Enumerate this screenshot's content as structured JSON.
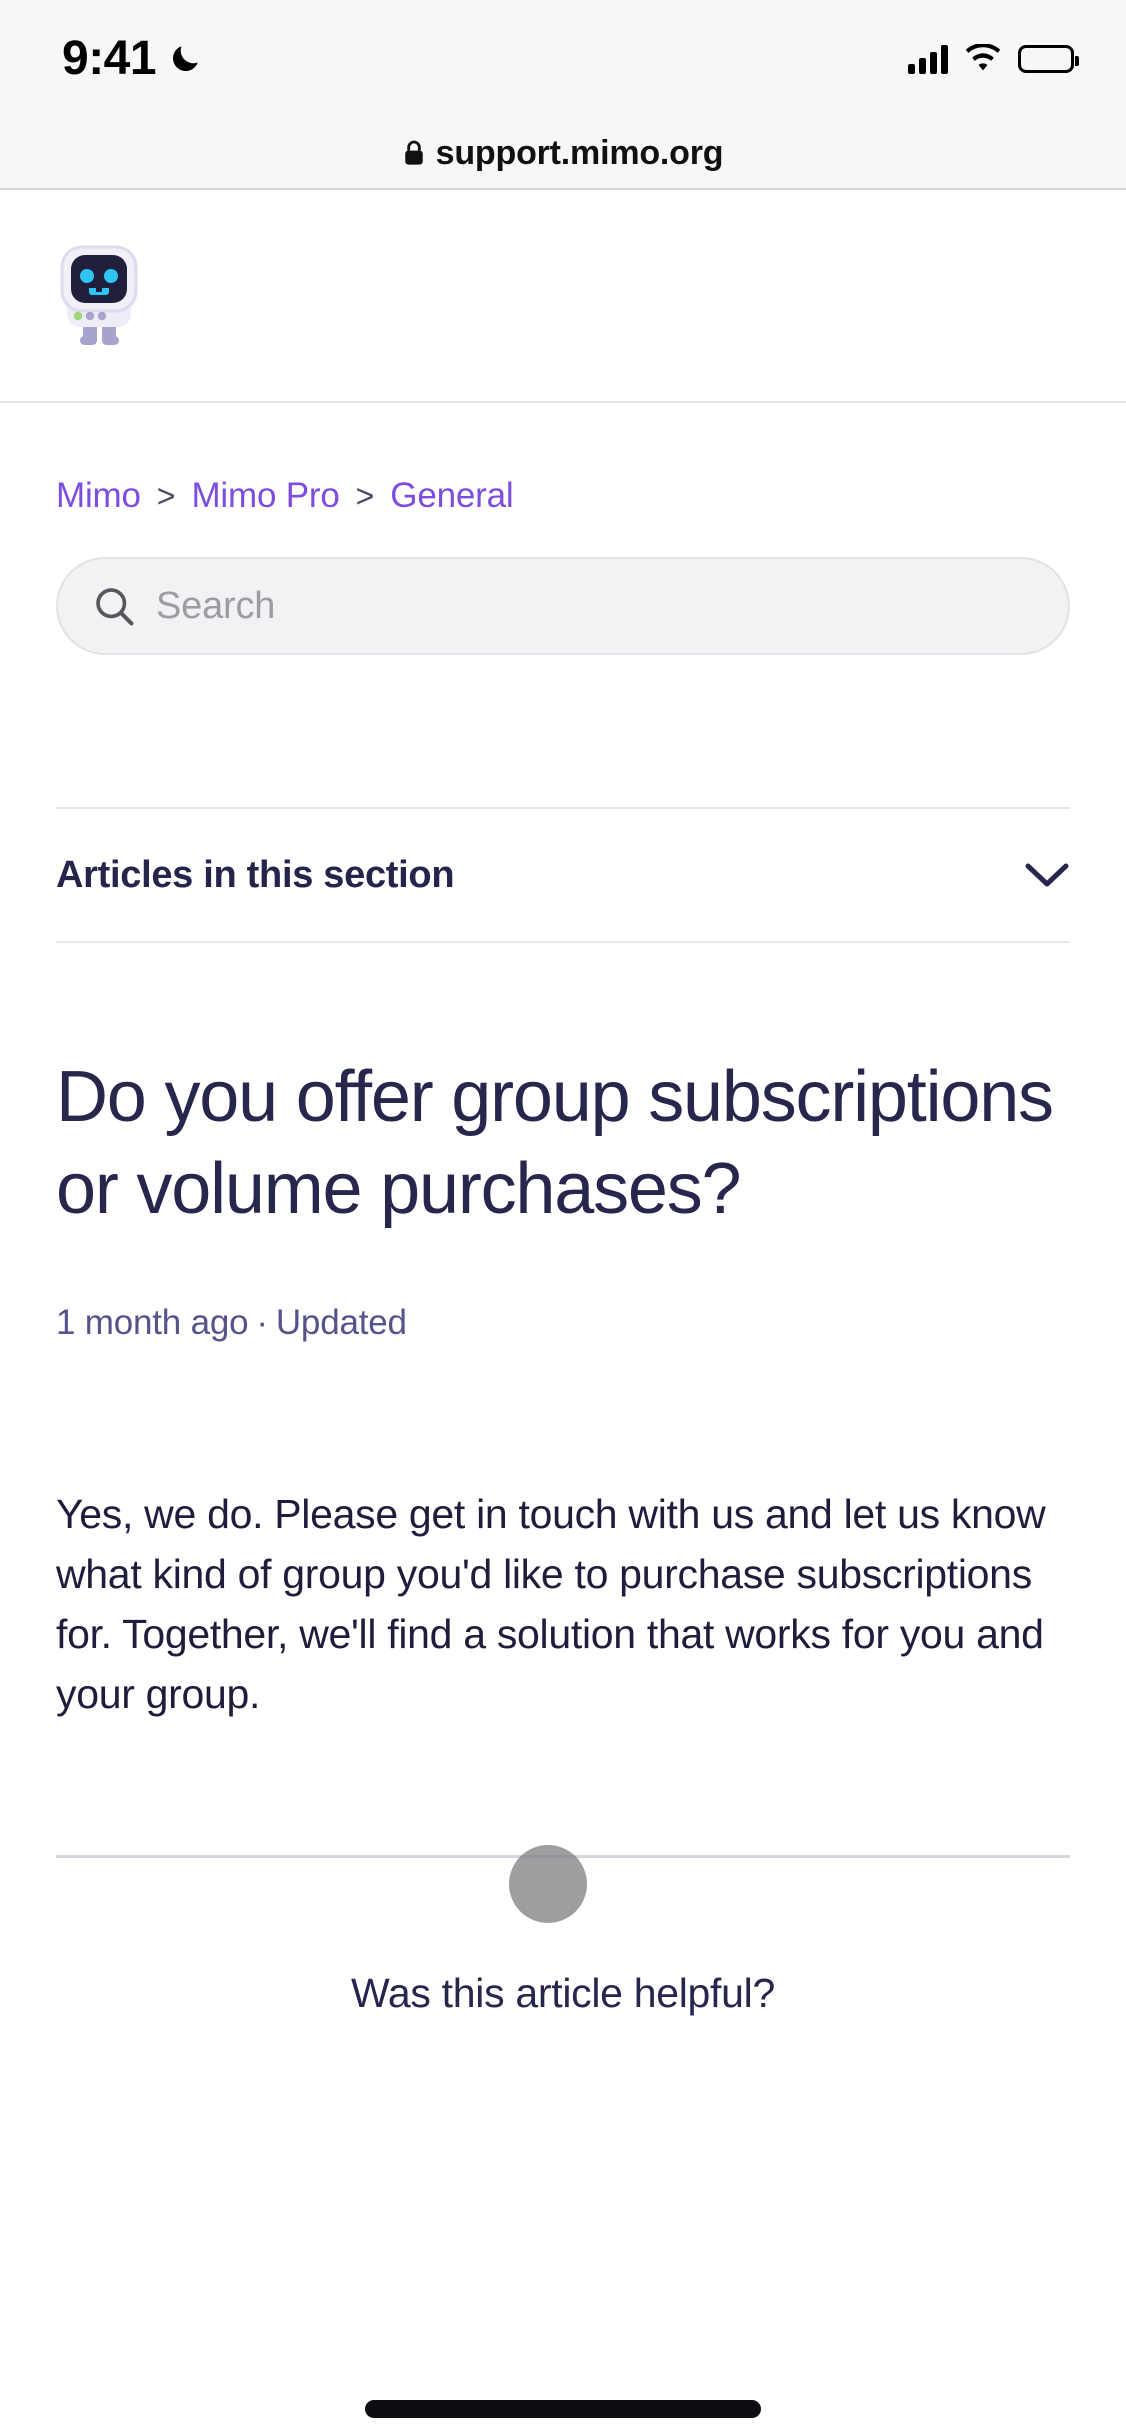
{
  "status_bar": {
    "time": "9:41",
    "dnd_icon": "moon-icon",
    "signal_icon": "cellular-signal-icon",
    "wifi_icon": "wifi-icon",
    "battery_icon": "battery-full-icon"
  },
  "browser": {
    "lock_icon": "lock-icon",
    "url": "support.mimo.org"
  },
  "site_header": {
    "logo_name": "mimo-robot-logo",
    "logo_colors": {
      "body": "#eceaf4",
      "screen": "#21203c",
      "eyes": "#2fc4f5",
      "legs": "#a6a3cc",
      "indicator_green": "#9fd977"
    }
  },
  "breadcrumb": {
    "items": [
      {
        "label": "Mimo"
      },
      {
        "label": "Mimo Pro"
      },
      {
        "label": "General"
      }
    ],
    "separator": ">",
    "link_color": "#7c4ddf"
  },
  "search": {
    "icon": "search-icon",
    "placeholder": "Search",
    "value": ""
  },
  "accordion": {
    "title": "Articles in this section",
    "chevron_icon": "chevron-down-icon",
    "expanded": false
  },
  "article": {
    "title": "Do you offer group subscriptions or volume purchases?",
    "meta_time": "1 month ago",
    "meta_separator": "·",
    "meta_status": "Updated",
    "body": "Yes, we do. Please get in touch with us and let us know what kind of group you'd like to purchase subscriptions for. Together, we'll find a solution that works for you and your group."
  },
  "footer": {
    "helpful_question": "Was this article helpful?"
  },
  "overlay": {
    "touch_indicator": "touch-point-indicator",
    "home_indicator": "home-indicator-bar"
  }
}
